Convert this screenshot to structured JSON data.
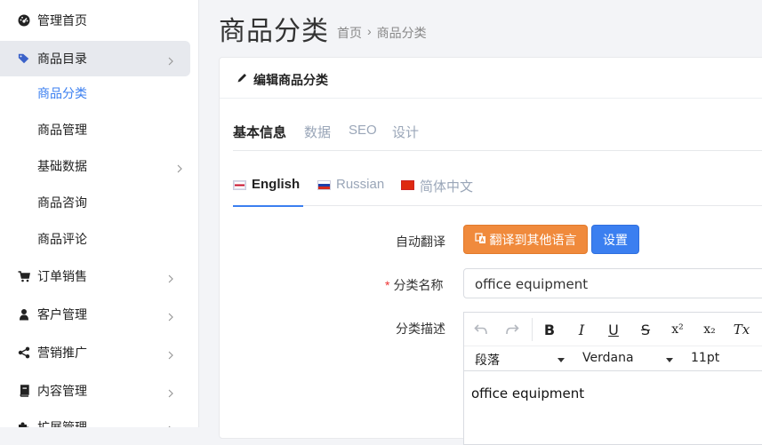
{
  "sidebar": {
    "items": [
      {
        "label": "管理首页",
        "icon": "dashboard-icon"
      },
      {
        "label": "商品目录",
        "icon": "tag-icon"
      },
      {
        "label": "订单销售",
        "icon": "cart-icon"
      },
      {
        "label": "客户管理",
        "icon": "user-icon"
      },
      {
        "label": "营销推广",
        "icon": "share-icon"
      },
      {
        "label": "内容管理",
        "icon": "book-icon"
      },
      {
        "label": "扩展管理",
        "icon": "extension-icon"
      }
    ],
    "subitems": [
      {
        "label": "商品分类"
      },
      {
        "label": "商品管理"
      },
      {
        "label": "基础数据"
      },
      {
        "label": "商品咨询"
      },
      {
        "label": "商品评论"
      }
    ]
  },
  "header": {
    "title": "商品分类",
    "breadcrumb": [
      "首页",
      "商品分类"
    ],
    "breadcrumb_sep": "›"
  },
  "card": {
    "title": "编辑商品分类",
    "tabs": [
      "基本信息",
      "数据",
      "SEO",
      "设计"
    ],
    "languages": [
      "English",
      "Russian",
      "简体中文"
    ]
  },
  "form": {
    "auto_translate_label": "自动翻译",
    "translate_button": "翻译到其他语言",
    "settings_button": "设置",
    "name_label": "分类名称",
    "required_mark": "*",
    "name_value": "office equipment",
    "desc_label": "分类描述",
    "editor": {
      "bold": "B",
      "italic": "I",
      "underline": "U",
      "strike": "S",
      "superscript": "x²",
      "subscript": "x₂",
      "clear": "Tx",
      "paragraph": "段落",
      "font": "Verdana",
      "size": "11pt",
      "content": "office equipment"
    }
  },
  "colors": {
    "accent": "#3b7ff0",
    "translate": "#f08a3c",
    "active_bg": "#e7e9ee"
  }
}
